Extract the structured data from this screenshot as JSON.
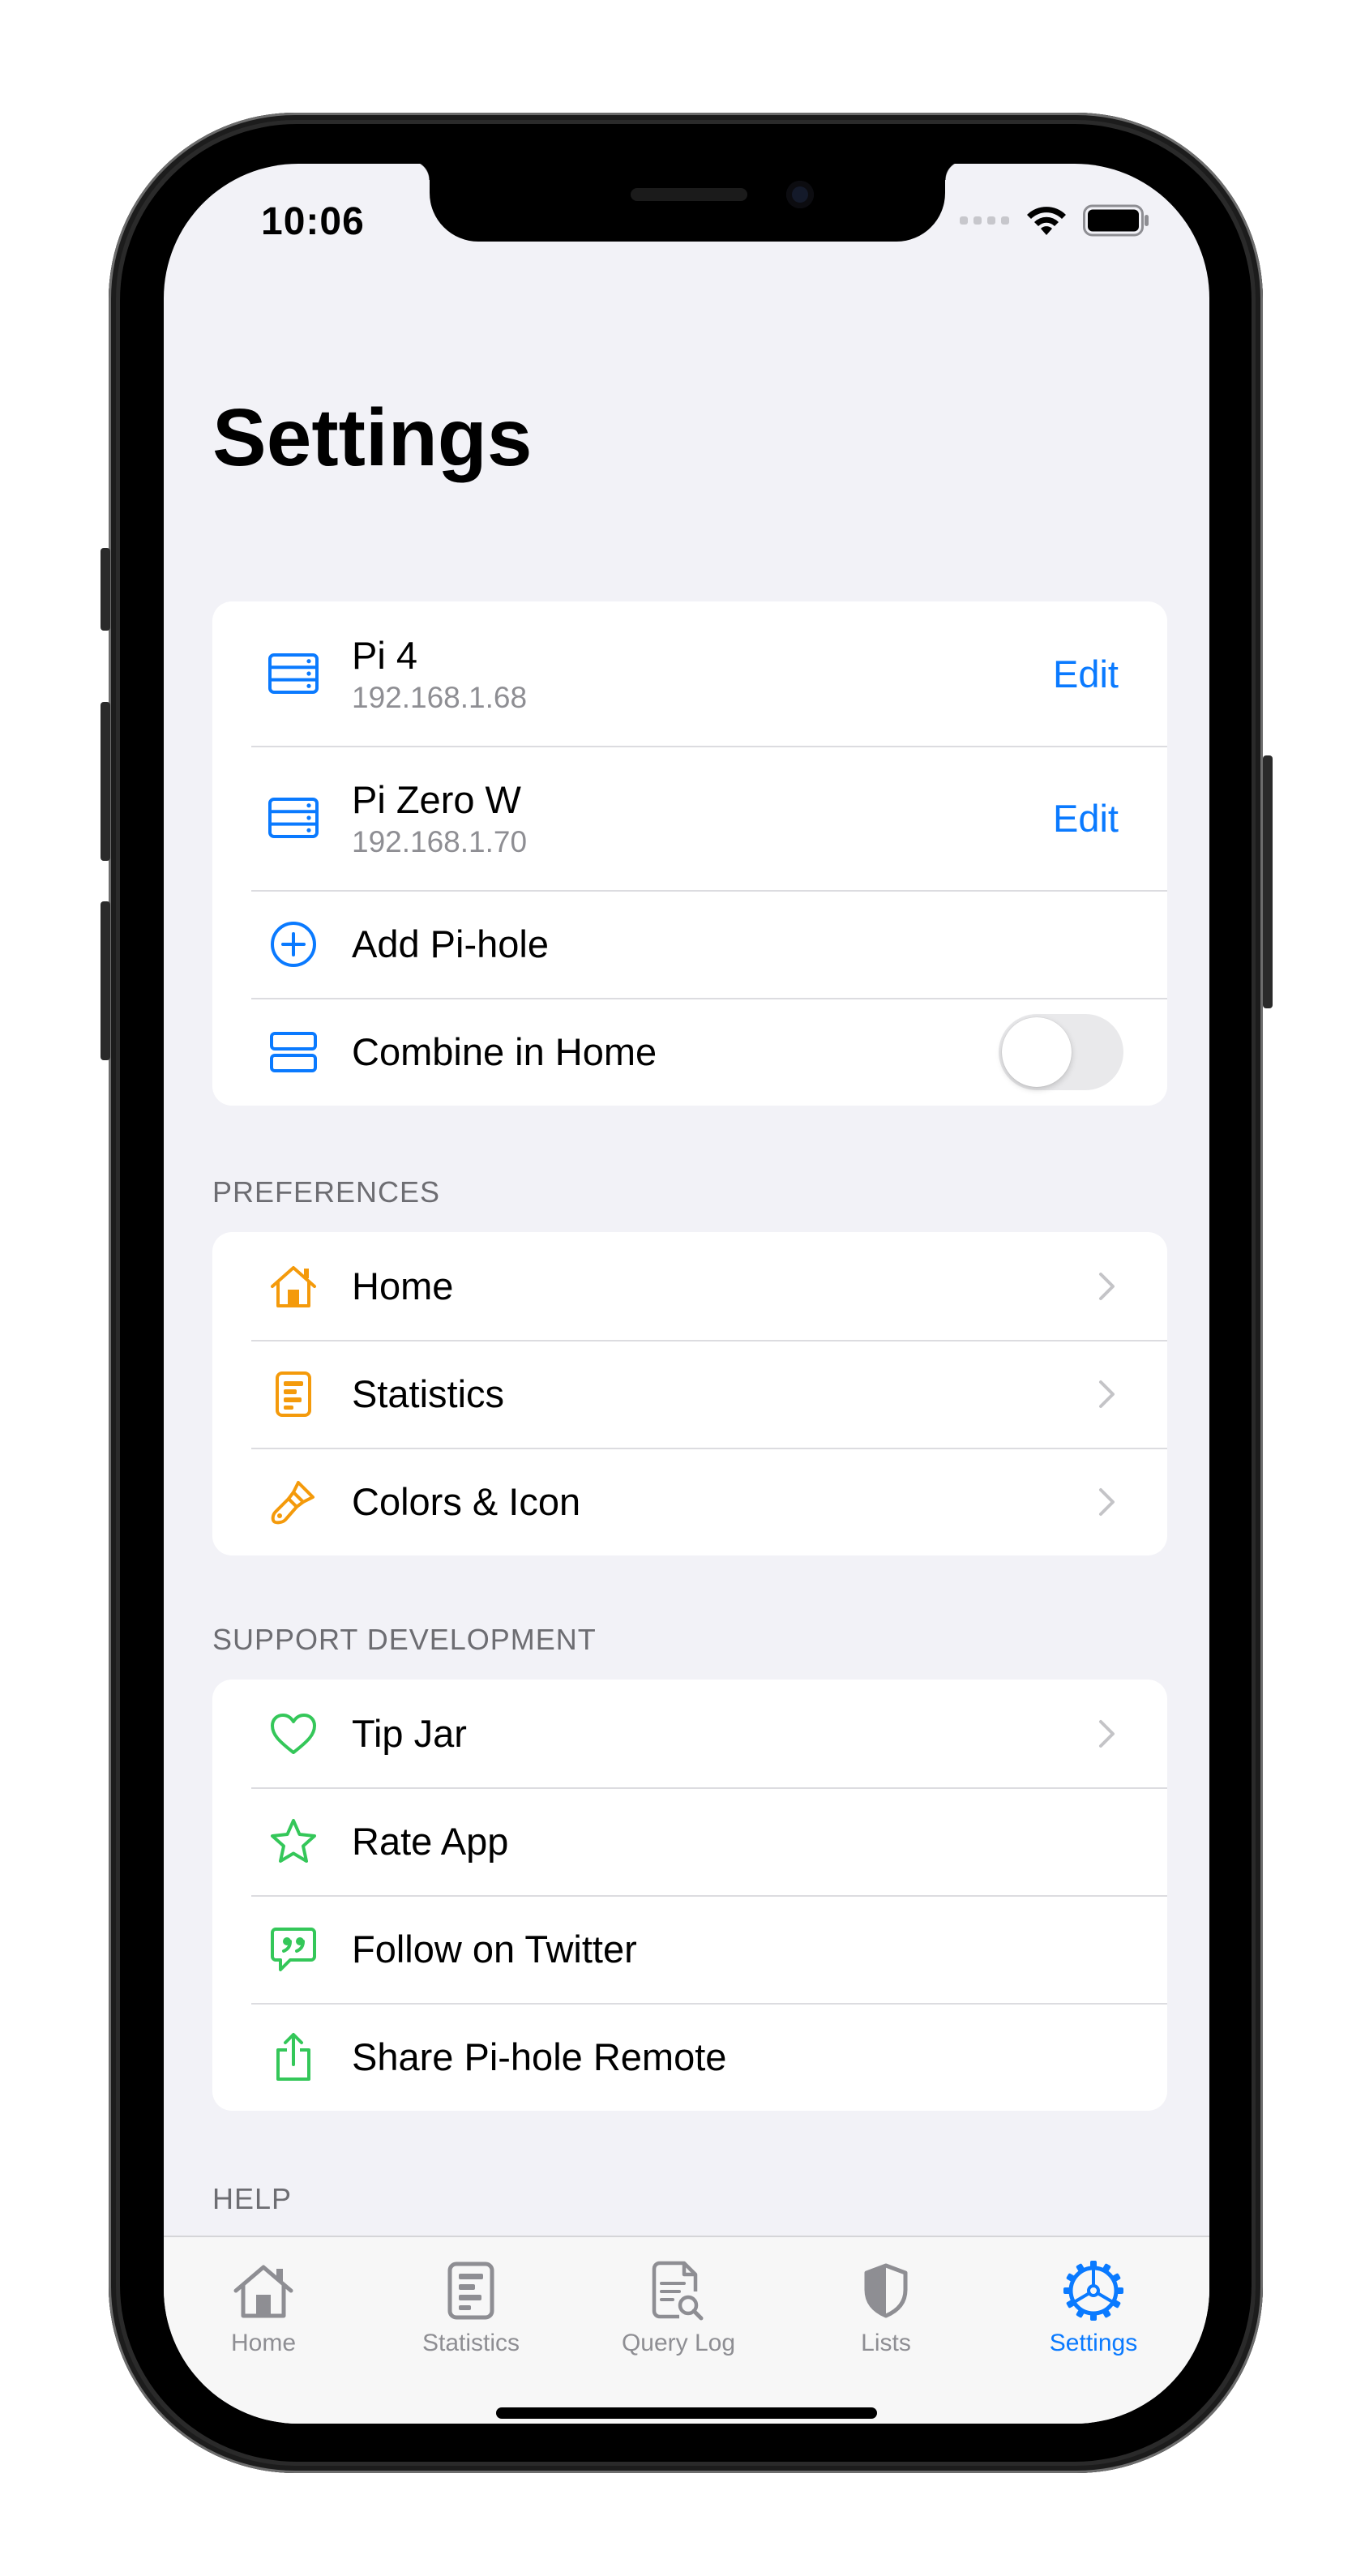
{
  "status_bar": {
    "time": "10:06"
  },
  "page": {
    "title": "Settings"
  },
  "servers": {
    "items": [
      {
        "name": "Pi 4",
        "address": "192.168.1.68",
        "action": "Edit",
        "icon": "server-icon"
      },
      {
        "name": "Pi Zero W",
        "address": "192.168.1.70",
        "action": "Edit",
        "icon": "server-icon"
      }
    ],
    "add_label": "Add Pi-hole",
    "combine_label": "Combine in Home",
    "combine_enabled": false
  },
  "preferences": {
    "header": "PREFERENCES",
    "items": [
      {
        "label": "Home",
        "icon": "house-icon"
      },
      {
        "label": "Statistics",
        "icon": "statistics-icon"
      },
      {
        "label": "Colors & Icon",
        "icon": "paintbrush-icon"
      }
    ]
  },
  "support": {
    "header": "SUPPORT DEVELOPMENT",
    "items": [
      {
        "label": "Tip Jar",
        "icon": "heart-icon",
        "chevron": true
      },
      {
        "label": "Rate App",
        "icon": "star-icon",
        "chevron": false
      },
      {
        "label": "Follow on Twitter",
        "icon": "quote-bubble-icon",
        "chevron": false
      },
      {
        "label": "Share Pi-hole Remote",
        "icon": "share-icon",
        "chevron": false
      }
    ]
  },
  "help": {
    "header": "HELP"
  },
  "tab_bar": {
    "tabs": [
      {
        "label": "Home",
        "icon": "house-icon",
        "active": false
      },
      {
        "label": "Statistics",
        "icon": "statistics-icon",
        "active": false
      },
      {
        "label": "Query Log",
        "icon": "query-log-icon",
        "active": false
      },
      {
        "label": "Lists",
        "icon": "shield-icon",
        "active": false
      },
      {
        "label": "Settings",
        "icon": "gear-icon",
        "active": true
      }
    ]
  },
  "colors": {
    "accent_blue": "#0a7aff",
    "preferences_orange": "#f49a0b",
    "support_green": "#34c759",
    "background": "#f2f2f7",
    "secondary_text": "#8e8e93"
  }
}
